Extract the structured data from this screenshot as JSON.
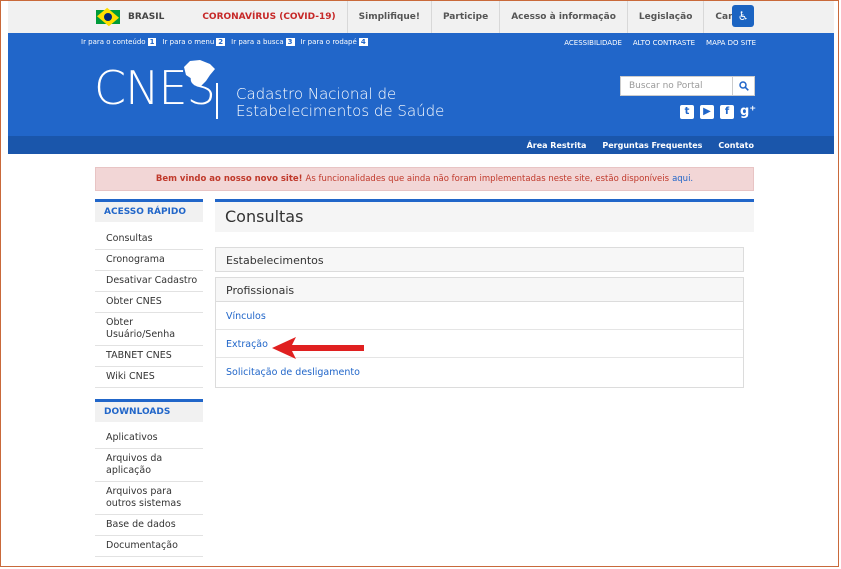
{
  "govbar": {
    "country": "BRASIL",
    "links": [
      "CORONAVÍRUS (COVID-19)",
      "Simplifique!",
      "Participe",
      "Acesso à informação",
      "Legislação",
      "Canais"
    ]
  },
  "header": {
    "skip_links": [
      {
        "label": "Ir para o conteúdo",
        "key": "1"
      },
      {
        "label": "Ir para o menu",
        "key": "2"
      },
      {
        "label": "Ir para a busca",
        "key": "3"
      },
      {
        "label": "Ir para o rodapé",
        "key": "4"
      }
    ],
    "top_links": [
      "ACESSIBILIDADE",
      "ALTO CONTRASTE",
      "MAPA DO SITE"
    ],
    "logo": "CNES",
    "site_name_line1": "Cadastro Nacional de",
    "site_name_line2": "Estabelecimentos de Saúde",
    "search_placeholder": "Buscar no Portal",
    "social": [
      "twitter-icon",
      "youtube-icon",
      "facebook-icon",
      "google-plus-icon"
    ]
  },
  "nav2": [
    "Área Restrita",
    "Perguntas Frequentes",
    "Contato"
  ],
  "banner": {
    "bold": "Bem vindo ao nosso novo site!",
    "text": "As funcionalidades que ainda não foram implementadas neste site, estão disponíveis",
    "link": "aqui."
  },
  "sidebar": {
    "quick_title": "ACESSO RÁPIDO",
    "quick_items": [
      "Consultas",
      "Cronograma",
      "Desativar Cadastro",
      "Obter CNES",
      "Obter Usuário/Senha",
      "TABNET CNES",
      "Wiki CNES"
    ],
    "downloads_title": "DOWNLOADS",
    "download_items": [
      "Aplicativos",
      "Arquivos da aplicação",
      "Arquivos para outros sistemas",
      "Base de dados",
      "Documentação"
    ]
  },
  "main": {
    "title": "Consultas",
    "sections": [
      "Estabelecimentos",
      "Profissionais"
    ],
    "links": [
      "Vínculos",
      "Extração",
      "Solicitação de desligamento"
    ]
  },
  "colors": {
    "brand_blue": "#2166c9",
    "nav_dark": "#1a56ab",
    "banner_bg": "#f2d6d6",
    "annotation_arrow": "#e02020"
  }
}
